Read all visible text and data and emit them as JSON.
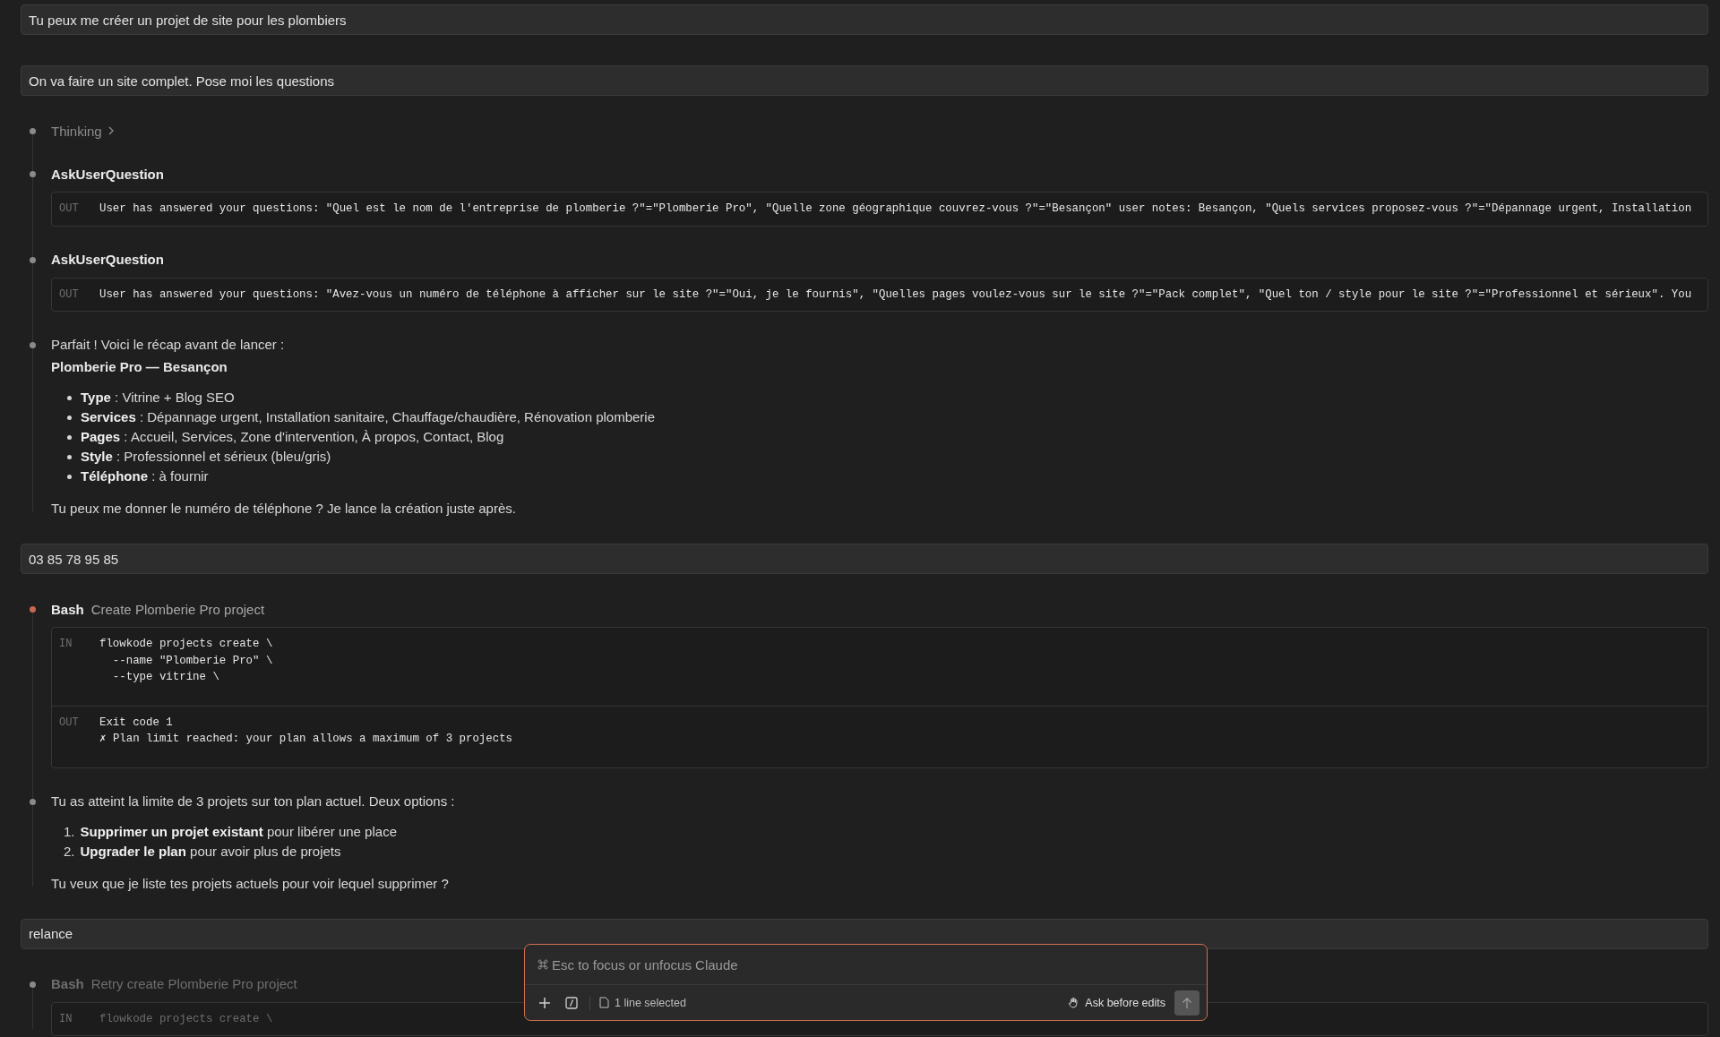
{
  "conversation": [
    {
      "kind": "user",
      "text": "Tu peux me créer un projet de site pour les plombiers"
    },
    {
      "kind": "user",
      "text": "On va faire un site complet. Pose moi les questions"
    },
    {
      "kind": "turn",
      "steps": [
        {
          "kind": "thinking",
          "label": "Thinking",
          "color": "#8a8a8a"
        },
        {
          "kind": "tool",
          "name": "AskUserQuestion",
          "color": "#8a8a8a",
          "sections": [
            {
              "tag": "OUT",
              "lines": [
                "User has answered your questions: \"Quel est le nom de l'entreprise de plomberie ?\"=\"Plomberie Pro\", \"Quelle zone géographique couvrez-vous ?\"=\"Besançon\" user notes: Besançon, \"Quels services proposez-vous ?\"=\"Dépannage urgent, Installation"
              ]
            }
          ]
        },
        {
          "kind": "tool",
          "name": "AskUserQuestion",
          "color": "#8a8a8a",
          "sections": [
            {
              "tag": "OUT",
              "lines": [
                "User has answered your questions: \"Avez-vous un numéro de téléphone à afficher sur le site ?\"=\"Oui, je le fournis\", \"Quelles pages voulez-vous sur le site ?\"=\"Pack complet\", \"Quel ton / style pour le site ?\"=\"Professionnel et sérieux\". You"
              ]
            }
          ]
        },
        {
          "kind": "assistant",
          "color": "#8a8a8a",
          "blocks": [
            {
              "kind": "p",
              "text": "Parfait ! Voici le récap avant de lancer :"
            },
            {
              "kind": "strong",
              "text": "Plomberie Pro — Besançon"
            },
            {
              "kind": "ul",
              "items": [
                {
                  "text": "**Type** : Vitrine + Blog SEO"
                },
                {
                  "text": "**Services** : Dépannage urgent, Installation sanitaire, Chauffage/chaudière, Rénovation plomberie"
                },
                {
                  "text": "**Pages** : Accueil, Services, Zone d'intervention, À propos, Contact, Blog"
                },
                {
                  "text": "**Style** : Professionnel et sérieux (bleu/gris)"
                },
                {
                  "text": "**Téléphone** : à fournir"
                }
              ]
            },
            {
              "kind": "p",
              "text": "Tu peux me donner le numéro de téléphone ? Je lance la création juste après."
            }
          ]
        }
      ]
    },
    {
      "kind": "user",
      "text": "03 85 78 95 85"
    },
    {
      "kind": "turn",
      "steps": [
        {
          "kind": "tool",
          "name": "Bash",
          "description": "Create Plomberie Pro project",
          "color": "#c8684f",
          "sections": [
            {
              "tag": "IN",
              "lines": [
                "flowkode projects create \\",
                "  --name \"Plomberie Pro\" \\",
                "  --type vitrine \\"
              ]
            },
            {
              "tag": "OUT",
              "lines": [
                "Exit code 1",
                "✗ Plan limit reached: your plan allows a maximum of 3 projects"
              ]
            }
          ]
        },
        {
          "kind": "assistant",
          "color": "#8a8a8a",
          "blocks": [
            {
              "kind": "p",
              "text": "Tu as atteint la limite de 3 projets sur ton plan actuel. Deux options :"
            },
            {
              "kind": "ol",
              "items": [
                {
                  "marker": "1.",
                  "text": "**Supprimer un projet existant** pour libérer une place"
                },
                {
                  "marker": "2.",
                  "text": "**Upgrader le plan** pour avoir plus de projets"
                }
              ]
            },
            {
              "kind": "p",
              "text": "Tu veux que je liste tes projets actuels pour voir lequel supprimer ?"
            }
          ]
        }
      ]
    },
    {
      "kind": "user",
      "text": "relance"
    },
    {
      "kind": "turn",
      "dimmed": true,
      "steps": [
        {
          "kind": "tool",
          "name": "Bash",
          "description": "Retry create Plomberie Pro project",
          "color": "#8a8a8a",
          "sections": [
            {
              "tag": "IN",
              "lines": [
                "flowkode projects create \\"
              ]
            }
          ]
        }
      ]
    }
  ],
  "composer": {
    "placeholder": "Esc to focus or unfocus Claude",
    "selection": "1 line selected",
    "mode": "Ask before edits"
  }
}
